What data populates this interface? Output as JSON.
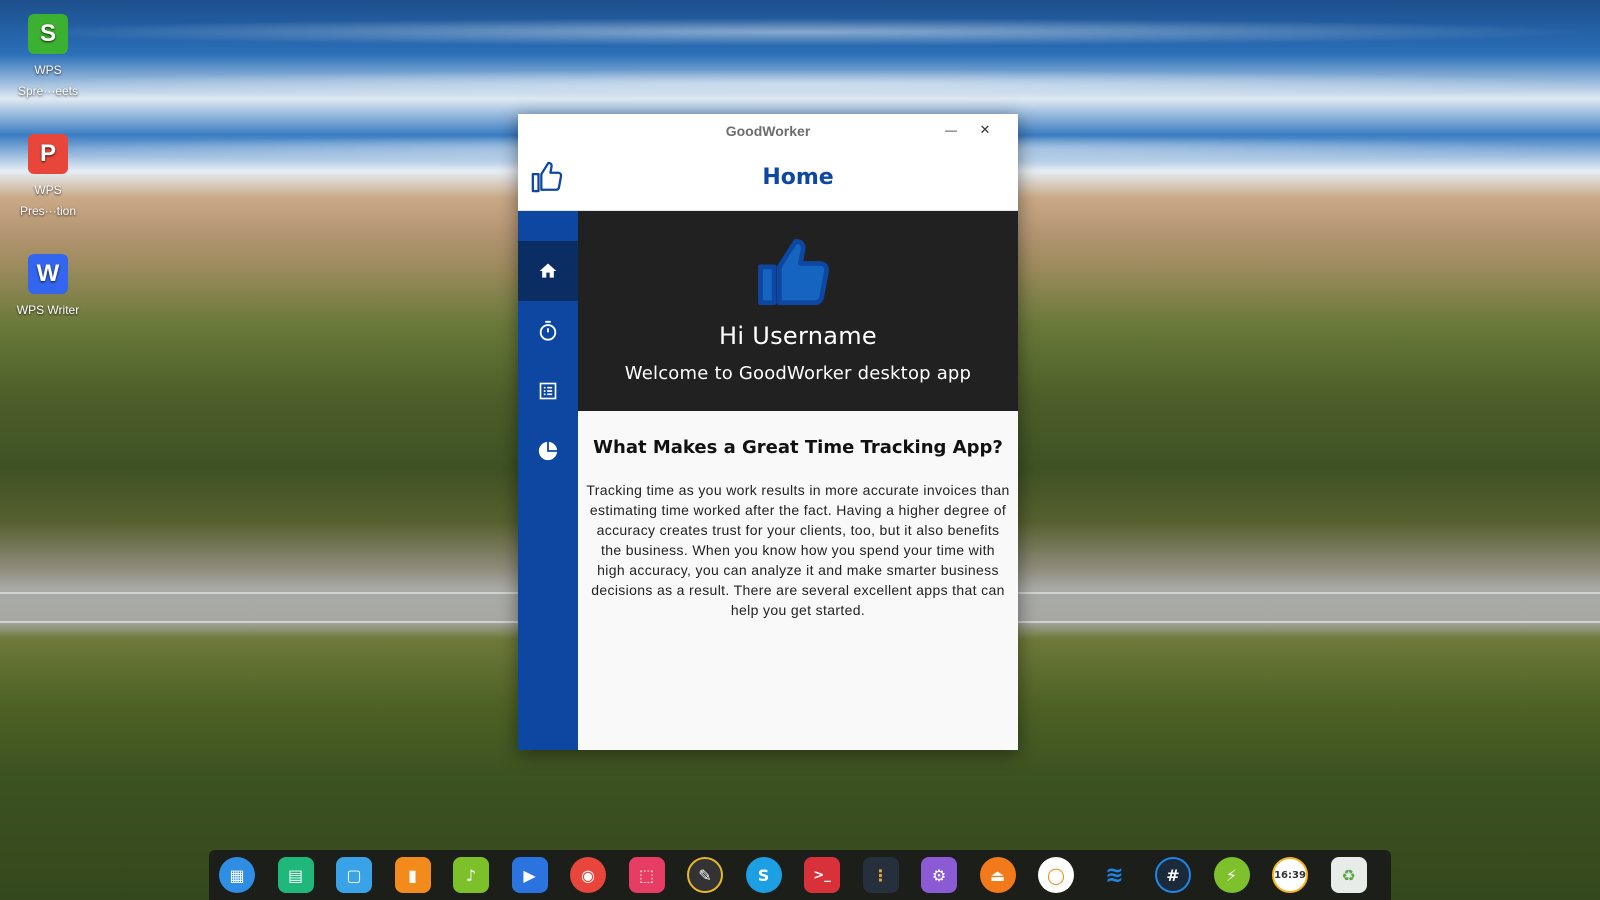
{
  "desktop": {
    "icons": [
      {
        "label": "WPS\nSpre···eets",
        "icon": "wps-spreadsheets-icon",
        "color": "#3cb030",
        "glyph": "S"
      },
      {
        "label": "WPS\nPres···tion",
        "icon": "wps-presentation-icon",
        "color": "#e8463a",
        "glyph": "P"
      },
      {
        "label": "WPS Writer",
        "icon": "wps-writer-icon",
        "color": "#3465ef",
        "glyph": "W"
      }
    ]
  },
  "window": {
    "title": "GoodWorker",
    "minimize_glyph": "—",
    "close_glyph": "✕"
  },
  "app": {
    "header_title": "Home",
    "accent_color": "#0d47a1",
    "nav": [
      {
        "name": "home",
        "icon": "home-icon",
        "active": true
      },
      {
        "name": "timer",
        "icon": "stopwatch-icon",
        "active": false
      },
      {
        "name": "list",
        "icon": "list-icon",
        "active": false
      },
      {
        "name": "reports",
        "icon": "pie-chart-icon",
        "active": false
      }
    ],
    "hero": {
      "greeting": "Hi Username",
      "welcome": "Welcome to GoodWorker desktop app"
    },
    "section": {
      "title": "What Makes a Great Time Tracking App?",
      "body": "Tracking time as you work results in more accurate invoices than estimating time worked after the fact. Having a higher degree of accuracy creates trust for your clients, too, but it also benefits the business. When you know how you spend your time with high accuracy, you can analyze it and make smarter business decisions as a result. There are several excellent apps that can help you get started."
    }
  },
  "dock": {
    "apps": [
      {
        "icon": "launcher-icon",
        "color": "#2f8de4",
        "glyph": "▦",
        "round": true
      },
      {
        "icon": "spreadsheet-icon",
        "color": "#1fb87a",
        "glyph": "▤",
        "round": false
      },
      {
        "icon": "file-manager-icon",
        "color": "#3aa2e6",
        "glyph": "▢",
        "round": false
      },
      {
        "icon": "app-store-icon",
        "color": "#f28a1c",
        "glyph": "▮",
        "round": false
      },
      {
        "icon": "music-icon",
        "color": "#7dc12a",
        "glyph": "♪",
        "round": false
      },
      {
        "icon": "video-player-icon",
        "color": "#2b74e0",
        "glyph": "▶",
        "round": false
      },
      {
        "icon": "chrome-icon",
        "color": "#e8453c",
        "glyph": "◉",
        "round": true
      },
      {
        "icon": "screenshot-icon",
        "color": "#e73c63",
        "glyph": "⬚",
        "round": false
      },
      {
        "icon": "color-picker-icon",
        "color": "#333333",
        "glyph": "✎",
        "round": true
      },
      {
        "icon": "skype-icon",
        "color": "#1d9fe4",
        "glyph": "S",
        "round": true
      },
      {
        "icon": "terminal-icon",
        "color": "#d9313a",
        "glyph": ">_",
        "round": false
      },
      {
        "icon": "code-editor-icon",
        "color": "#26303c",
        "glyph": "⋮",
        "round": false
      },
      {
        "icon": "settings-icon",
        "color": "#8b5bd6",
        "glyph": "⚙",
        "round": false
      },
      {
        "icon": "eject-icon",
        "color": "#f27a1a",
        "glyph": "⏏",
        "round": true
      },
      {
        "icon": "search-ring-icon",
        "color": "#ffffff",
        "glyph": "◯",
        "round": true
      },
      {
        "icon": "wifi-icon",
        "color": "#1f86e8",
        "glyph": "≋",
        "round": true
      },
      {
        "icon": "control-center-icon",
        "color": "#1b2a3a",
        "glyph": "#",
        "round": true
      },
      {
        "icon": "power-icon",
        "color": "#7fc12c",
        "glyph": "⚡",
        "round": true
      },
      {
        "icon": "clock-icon",
        "color": "#ffffff",
        "glyph": "",
        "round": true
      },
      {
        "icon": "trash-icon",
        "color": "#e8ece8",
        "glyph": "♻",
        "round": false
      }
    ],
    "clock_text": "16:39"
  }
}
